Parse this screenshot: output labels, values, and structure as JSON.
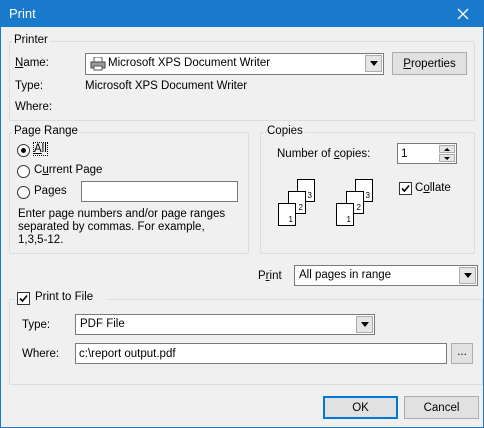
{
  "window": {
    "title": "Print",
    "close_icon": "close-icon"
  },
  "printer": {
    "legend": "Printer",
    "name_label": "Name:",
    "name_value": "Microsoft XPS Document Writer",
    "printer_icon": "printer-icon",
    "properties_button": "Properties",
    "type_label": "Type:",
    "type_value": "Microsoft XPS Document Writer",
    "where_label": "Where:",
    "where_value": ""
  },
  "page_range": {
    "legend": "Page Range",
    "all_label": "All",
    "current_page_label": "Current Page",
    "pages_label": "Pages",
    "pages_value": "",
    "selected": "All",
    "help_line1": "Enter page numbers and/or page ranges",
    "help_line2": "separated by commas.  For example,",
    "help_line3": "1,3,5-12."
  },
  "copies": {
    "legend": "Copies",
    "number_label": "Number of copies:",
    "number_value": "1",
    "collate_label": "Collate",
    "collate_checked": true,
    "collate_pages": [
      "1",
      "2",
      "3"
    ]
  },
  "print_what": {
    "label": "Print",
    "value": "All pages in range"
  },
  "print_to_file": {
    "label": "Print to File",
    "checked": true,
    "type_label": "Type:",
    "type_value": "PDF File",
    "where_label": "Where:",
    "where_value": "c:\\report output.pdf",
    "browse_label": "..."
  },
  "buttons": {
    "ok": "OK",
    "cancel": "Cancel"
  },
  "colors": {
    "titlebar": "#1979ca",
    "dialog_bg": "#f0f0f0",
    "group_border": "#d5dfe5"
  }
}
